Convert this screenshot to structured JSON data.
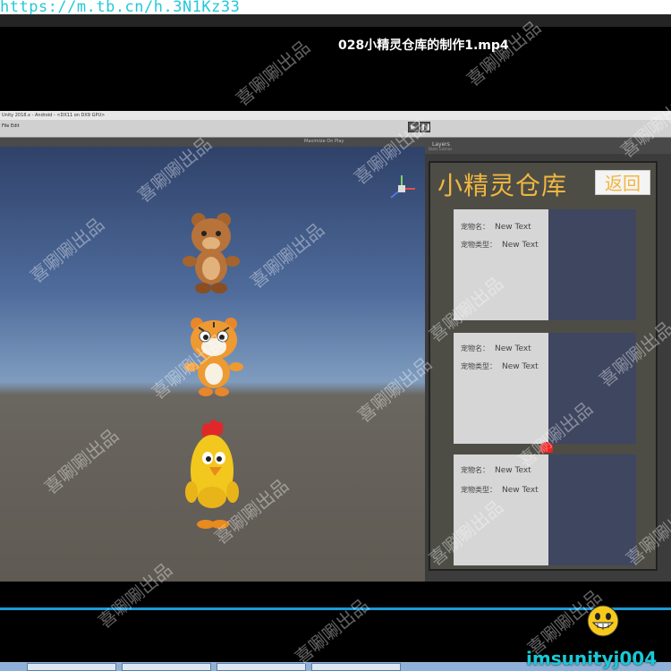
{
  "browser": {
    "url": "https://m.tb.cn/h.3N1Kz33"
  },
  "video": {
    "title": "028小精灵仓库的制作1.mp4"
  },
  "unity": {
    "title_bar": "Unity 2018.x - Android - <DX11 on DX9 GPU>",
    "toolbar_label": "File  Edit",
    "game_view_label": "Maximize On Play",
    "inspector_tab": "Layers",
    "inspector_sub": "Stats   Gizmos"
  },
  "warehouse": {
    "title": "小精灵仓库",
    "back_button": "返回",
    "cards": [
      {
        "name_label": "宠物名：",
        "name_value": "New Text",
        "type_label": "宠物类型：",
        "type_value": "New Text"
      },
      {
        "name_label": "宠物名：",
        "name_value": "New Text",
        "type_label": "宠物类型：",
        "type_value": "New Text"
      },
      {
        "name_label": "宠物名：",
        "name_value": "New Text",
        "type_label": "宠物类型：",
        "type_value": "New Text"
      }
    ]
  },
  "scene": {
    "characters": [
      "bear",
      "tiger",
      "chicken"
    ]
  },
  "watermark": "喜唰唰出品",
  "channel": "imsunityj004",
  "colors": {
    "accent_gold": "#f1b640",
    "url_cyan": "#24c8d8",
    "card_bg": "#d6d6d6",
    "card_image": "#3e4660",
    "progress_blue": "#1b9ad6"
  }
}
